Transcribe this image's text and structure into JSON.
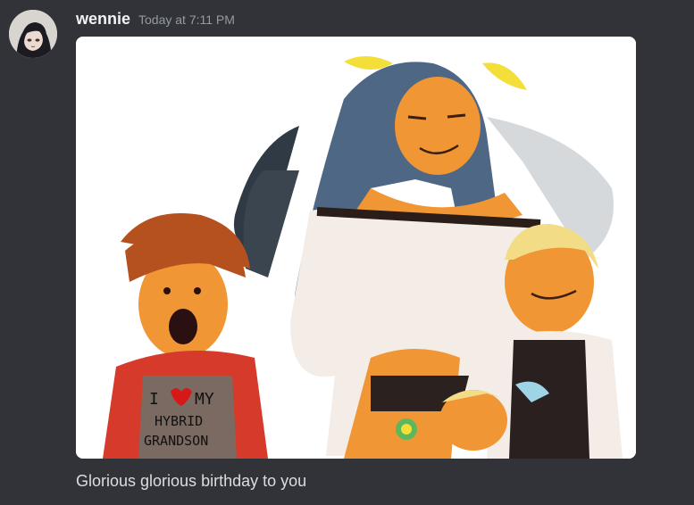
{
  "message": {
    "username": "wennie",
    "timestamp": "Today at 7:11 PM",
    "content": "Glorious glorious birthday to you",
    "avatar_icon": "user-avatar",
    "attachment": {
      "type": "image",
      "icon": "drawing-image",
      "shirt_text": [
        "I",
        "MY",
        "HYBRID",
        "GRANDSON"
      ]
    }
  },
  "colors": {
    "background": "#313338",
    "username": "#f2f3f5",
    "timestamp": "#949ba4",
    "content": "#dbdee1"
  }
}
